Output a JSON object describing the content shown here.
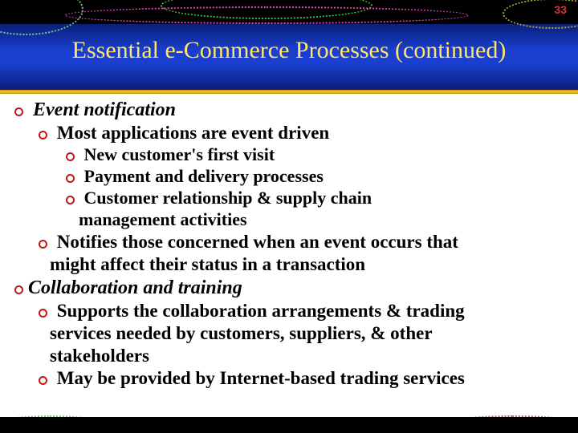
{
  "pageNumber": "33",
  "title": "Essential e-Commerce Processes (continued)",
  "items": {
    "event": {
      "heading": "Event notification",
      "sub1": "Most applications are event driven",
      "visit": "New customer's first visit",
      "payment": "Payment and delivery processes",
      "crm": "Customer relationship & supply chain",
      "crm2": "management activities",
      "notify1": "Notifies those concerned when an event occurs that",
      "notify2": "might affect their status in a transaction"
    },
    "collab": {
      "heading": "Collaboration and training",
      "support1": "Supports the collaboration arrangements & trading",
      "support2": "services needed by customers, suppliers, & other",
      "support3": "stakeholders",
      "provided": "May be provided by Internet-based trading services"
    }
  }
}
